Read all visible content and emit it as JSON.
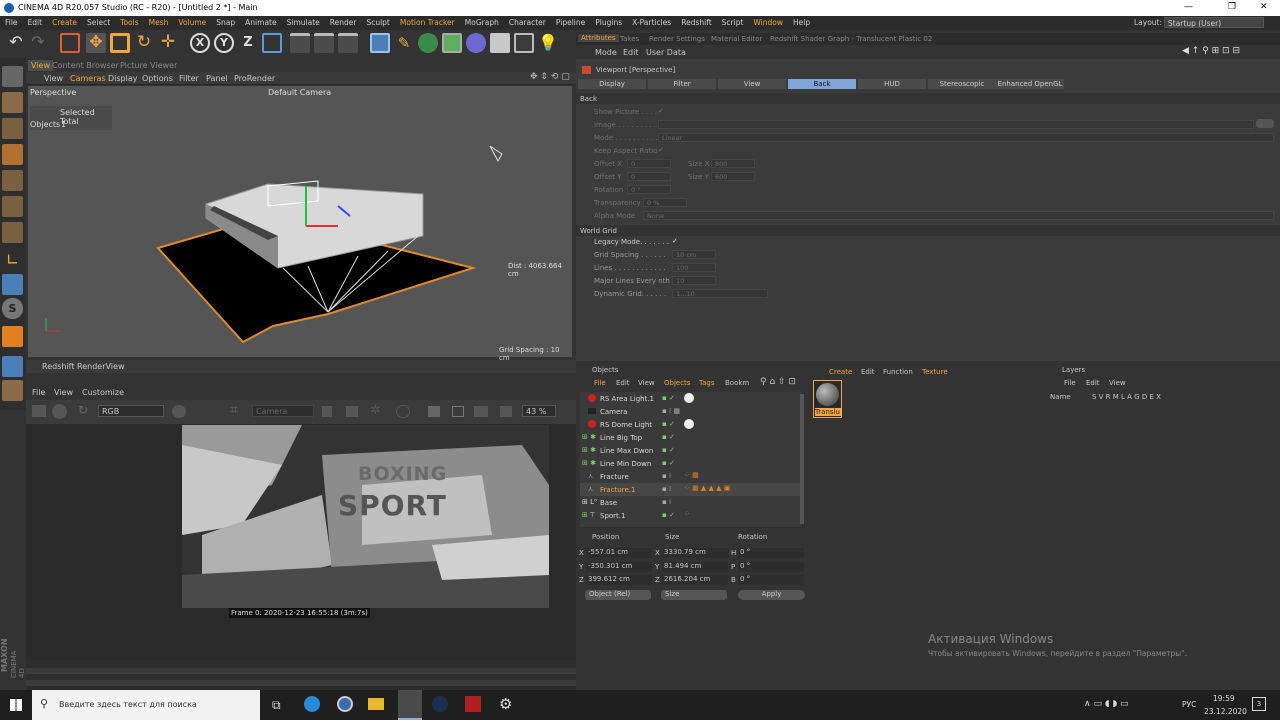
{
  "window": {
    "title": "CINEMA 4D R20.057 Studio (RC - R20) - [Untitled 2 *] - Main",
    "min": "—",
    "max": "❐",
    "close": "✕"
  },
  "menubar": [
    "File",
    "Edit",
    "Create",
    "Select",
    "Tools",
    "Mesh",
    "Volume",
    "Snap",
    "Animate",
    "Simulate",
    "Render",
    "Sculpt",
    "Motion Tracker",
    "MoGraph",
    "Character",
    "Pipeline",
    "Plugins",
    "X-Particles",
    "Redshift",
    "Script",
    "Window",
    "Help"
  ],
  "layout": {
    "label": "Layout:",
    "value": "Startup (User)"
  },
  "viewport": {
    "tabs": [
      "View",
      "Content Browser",
      "Picture Viewer"
    ],
    "menu": [
      "View",
      "Cameras",
      "Display",
      "Options",
      "Filter",
      "Panel",
      "ProRender"
    ],
    "name": "Perspective",
    "camera": "Default Camera",
    "hud_selected": "Selected Total",
    "hud_objects_label": "Objects",
    "hud_objects_value": "1",
    "dist": "Dist : 4063.664 cm",
    "grid_spacing": "Grid Spacing : 10 cm"
  },
  "renderview": {
    "title": "Redshift RenderView",
    "menu": [
      "File",
      "View",
      "Customize"
    ],
    "color_mode": "RGB",
    "camera": "Camera",
    "zoom": "43 %",
    "frame_info": "Frame  0:  2020-12-23  16:55:18  (3m:7s)",
    "render_text_1": "BOXING",
    "render_text_2": "SPORT"
  },
  "attributes": {
    "tabs": [
      "Attributes",
      "Takes",
      "Render Settings",
      "Material Editor",
      "Redshift Shader Graph - Translucent Plastic 02"
    ],
    "menu": [
      "Mode",
      "Edit",
      "User Data"
    ],
    "title": "Viewport [Perspective]",
    "subtabs": [
      "Display",
      "Filter",
      "View",
      "Back",
      "HUD",
      "Stereoscopic",
      "Enhanced OpenGL"
    ],
    "active_subtab": "Back",
    "section_back": "Back",
    "show_picture": "Show Picture . . . .",
    "image": "Image . . . . . . . . . .",
    "mode_label": "Mode . . . . . . . . . .",
    "mode_value": "Linear",
    "keep_aspect": "Keep Aspect Ratio",
    "offset_x": "Offset X",
    "offset_x_val": "0",
    "size_x": "Size X",
    "size_x_val": "800",
    "offset_y": "Offset Y",
    "offset_y_val": "0",
    "size_y": "Size Y",
    "size_y_val": "600",
    "rotation": "Rotation",
    "rotation_val": "0 °",
    "transparency": "Transparency",
    "transparency_val": "0 %",
    "alpha_mode": "Alpha Mode",
    "alpha_mode_val": "None",
    "section_grid": "World Grid",
    "legacy_mode": "Legacy Mode. . . . . . .",
    "grid_spacing": "Grid Spacing . . . . . .",
    "grid_spacing_val": "10 cm",
    "lines": "Lines . . . . . . . . . . . .",
    "lines_val": "100",
    "major_lines": "Major Lines Every nth",
    "major_lines_val": "10",
    "dynamic_grid": "Dynamic Grid. . . . . .",
    "dynamic_grid_val": "1...10",
    "check": "✓"
  },
  "objects": {
    "title": "Objects",
    "menu": [
      "File",
      "Edit",
      "View",
      "Objects",
      "Tags",
      "Bookm"
    ],
    "rows": [
      {
        "name": "RS Area Light.1",
        "color": "#d8d8d8"
      },
      {
        "name": "Camera",
        "color": "#d8d8d8"
      },
      {
        "name": "RS Dome Light",
        "color": "#d8d8d8"
      },
      {
        "name": "Line Big Top",
        "color": "#d8d8d8"
      },
      {
        "name": "Line Max Dwon",
        "color": "#d8d8d8"
      },
      {
        "name": "Line Min Down",
        "color": "#d8d8d8"
      },
      {
        "name": "Fracture",
        "color": "#d8d8d8"
      },
      {
        "name": "Fracture.1",
        "color": "#f2a740"
      },
      {
        "name": "Base",
        "color": "#d8d8d8"
      },
      {
        "name": "Sport.1",
        "color": "#d8d8d8"
      }
    ]
  },
  "coords": {
    "headers": [
      "Position",
      "Size",
      "Rotation"
    ],
    "rows": [
      {
        "axis": "X",
        "pos": "-557.01 cm",
        "saxis": "X",
        "size": "3330.79 cm",
        "raxis": "H",
        "rot": "0 °"
      },
      {
        "axis": "Y",
        "pos": "-350.301 cm",
        "saxis": "Y",
        "size": "81.494 cm",
        "raxis": "P",
        "rot": "0 °"
      },
      {
        "axis": "Z",
        "pos": "399.612 cm",
        "saxis": "Z",
        "size": "2616.204 cm",
        "raxis": "B",
        "rot": "0 °"
      }
    ],
    "mode": "Object (Rel)",
    "size_mode": "Size",
    "apply": "Apply"
  },
  "materials": {
    "menu": [
      "Create",
      "Edit",
      "Function",
      "Texture"
    ],
    "item": "Translu"
  },
  "layers": {
    "title": "Layers",
    "menu": [
      "File",
      "Edit",
      "View"
    ],
    "header": "Name",
    "cols": "S V R M L A G D E X"
  },
  "watermark": {
    "line1": "Активация Windows",
    "line2": "Чтобы активировать Windows, перейдите в раздел \"Параметры\"."
  },
  "brand": {
    "line1": "MAXON",
    "line2": "CINEMA 4D"
  },
  "taskbar": {
    "search_placeholder": "Введите здесь текст для поиска",
    "lang": "РУС",
    "time": "19:59",
    "date": "23.12.2020",
    "notif": "3"
  }
}
